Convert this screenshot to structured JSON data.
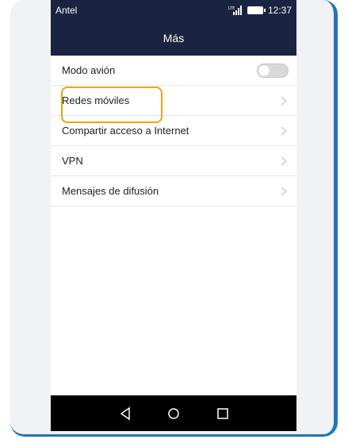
{
  "status_bar": {
    "carrier": "Antel",
    "signal_icon": "lte-signal-icon",
    "battery_icon": "battery-icon",
    "time": "12:37"
  },
  "header": {
    "title": "Más"
  },
  "settings": {
    "items": [
      {
        "label": "Modo avión",
        "control": "toggle",
        "toggle_on": false
      },
      {
        "label": "Redes móviles",
        "control": "chevron",
        "highlighted": true
      },
      {
        "label": "Compartir acceso a Internet",
        "control": "chevron"
      },
      {
        "label": "VPN",
        "control": "chevron"
      },
      {
        "label": "Mensajes de difusión",
        "control": "chevron"
      }
    ]
  },
  "nav_bar": {
    "buttons": [
      "back-icon",
      "home-icon",
      "recents-icon"
    ]
  },
  "colors": {
    "header_bg": "#1a2340",
    "highlight": "#f2a500",
    "frame_accent": "#1f75bd"
  }
}
